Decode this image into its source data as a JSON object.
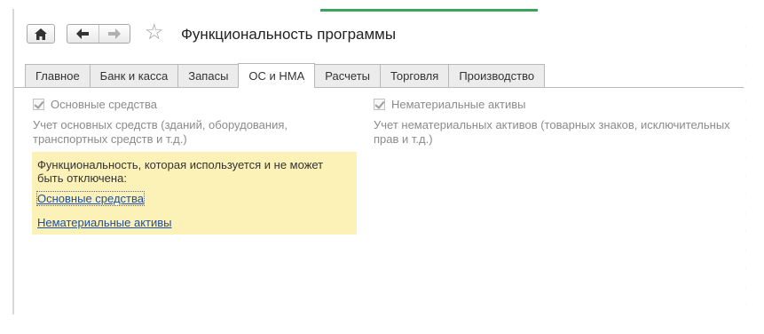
{
  "toolbar": {
    "home_icon": "home-icon",
    "back_icon": "arrow-left-icon",
    "forward_icon": "arrow-right-icon",
    "favorite_icon": "star-icon"
  },
  "window": {
    "title": "Функциональность программы"
  },
  "tabs": [
    {
      "label": "Главное",
      "active": false
    },
    {
      "label": "Банк и касса",
      "active": false
    },
    {
      "label": "Запасы",
      "active": false
    },
    {
      "label": "ОС и НМА",
      "active": true
    },
    {
      "label": "Расчеты",
      "active": false
    },
    {
      "label": "Торговля",
      "active": false
    },
    {
      "label": "Производство",
      "active": false
    }
  ],
  "options": {
    "fixed_assets": {
      "label": "Основные средства",
      "checked": true,
      "disabled": true,
      "description": "Учет основных средств (зданий, оборудования, транспортных средств и т.д.)"
    },
    "intangible_assets": {
      "label": "Нематериальные активы",
      "checked": true,
      "disabled": true,
      "description": "Учет нематериальных активов (товарных знаков, исключительных прав и т.д.)"
    }
  },
  "info_panel": {
    "text": "Функциональность, которая используется и не может быть отключена:",
    "links": [
      "Основные средства",
      "Нематериальные активы"
    ],
    "background": "#fcf2b8"
  },
  "colors": {
    "link": "#1f4ea1",
    "accent_strip": "#3aa55a"
  }
}
